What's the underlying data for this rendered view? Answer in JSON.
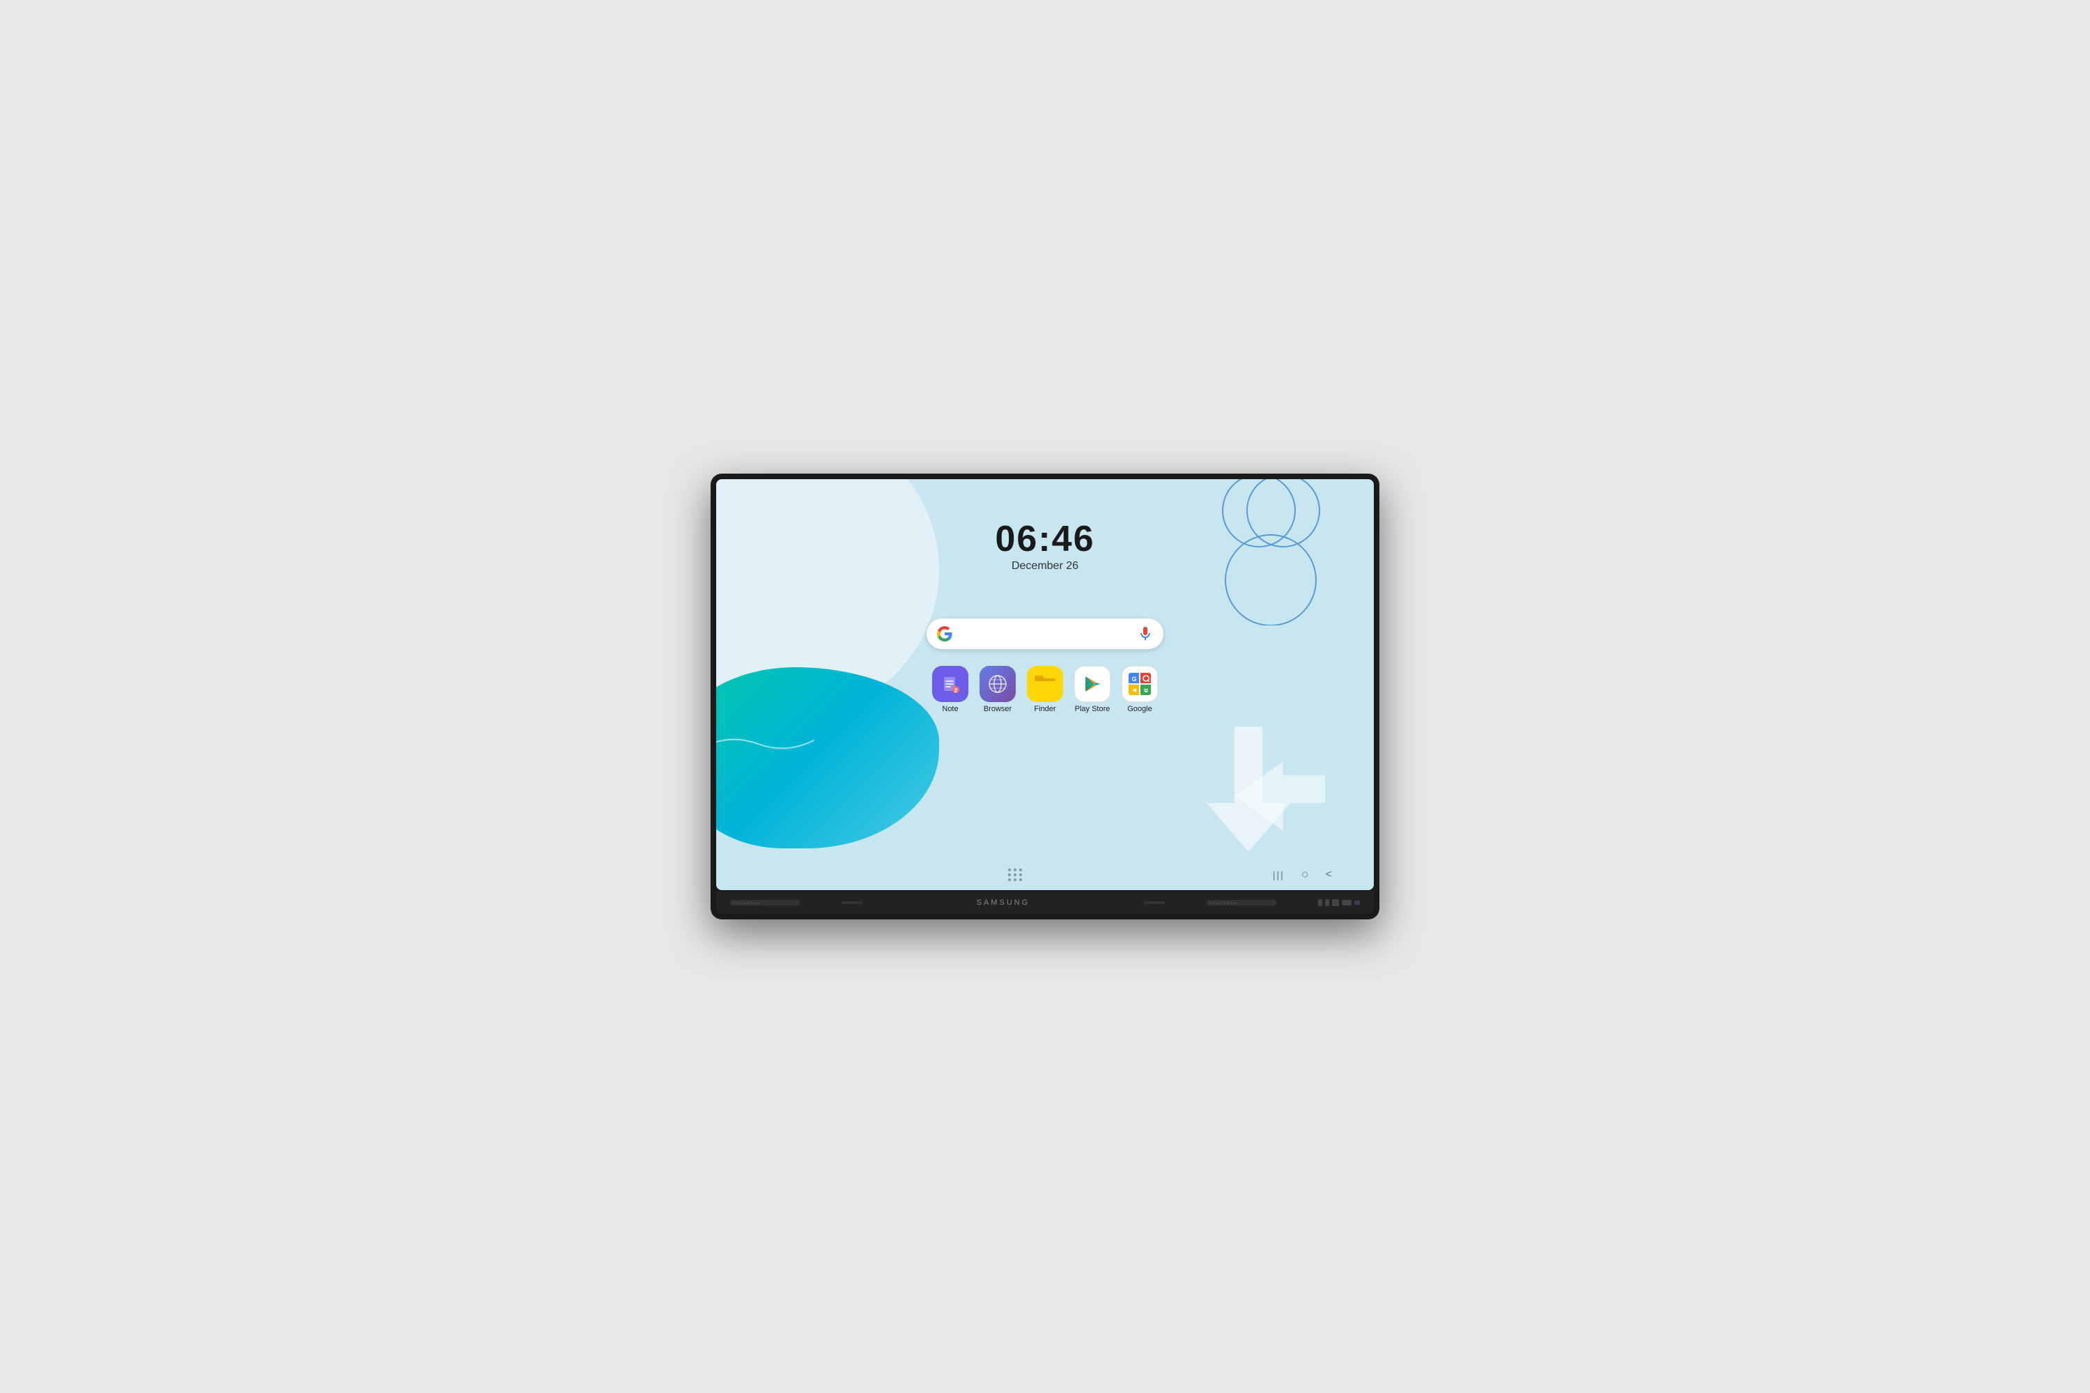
{
  "device": {
    "brand": "SAMSUNG",
    "type": "smart-display"
  },
  "screen": {
    "clock": {
      "time": "06:46",
      "date": "December 26"
    },
    "search": {
      "placeholder": ""
    },
    "apps": [
      {
        "id": "note",
        "label": "Note",
        "icon_type": "note",
        "color": "#6c5ce7"
      },
      {
        "id": "browser",
        "label": "Browser",
        "icon_type": "browser",
        "color": "#7c6ce7"
      },
      {
        "id": "finder",
        "label": "Finder",
        "icon_type": "folder",
        "color": "#ffd60a"
      },
      {
        "id": "playstore",
        "label": "Play Store",
        "icon_type": "playstore",
        "color": "#ffffff"
      },
      {
        "id": "google",
        "label": "Google",
        "icon_type": "google",
        "color": "#ffffff"
      }
    ],
    "nav": {
      "recent_label": "|||",
      "home_label": "○",
      "back_label": "<"
    }
  }
}
